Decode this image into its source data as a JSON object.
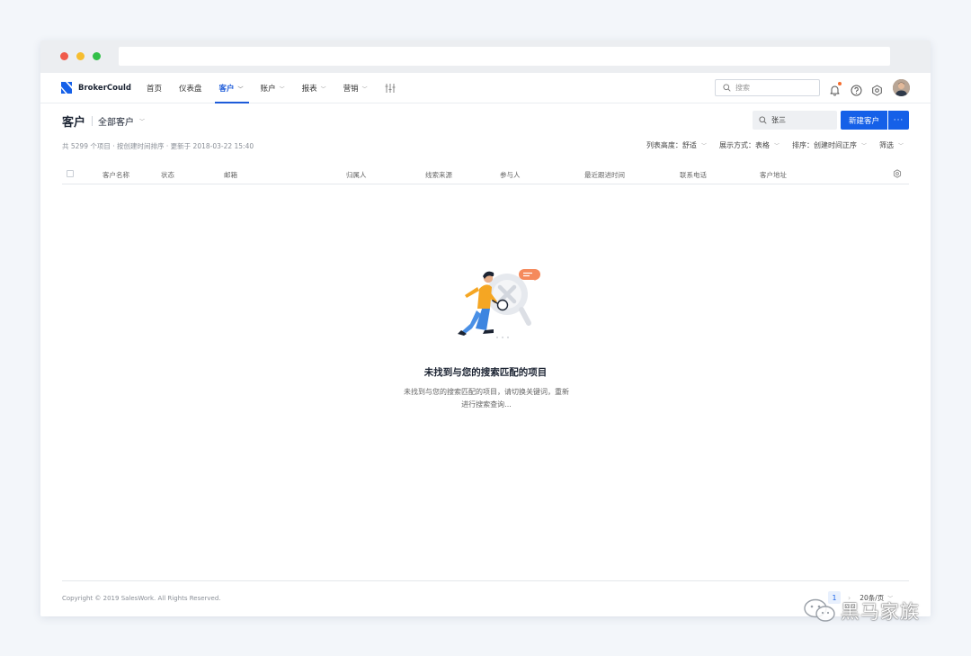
{
  "brand": {
    "name": "BrokerCould"
  },
  "nav": {
    "items": [
      {
        "label": "首页",
        "has_dropdown": false,
        "active": false
      },
      {
        "label": "仪表盘",
        "has_dropdown": false,
        "active": false
      },
      {
        "label": "客户",
        "has_dropdown": true,
        "active": true
      },
      {
        "label": "账户",
        "has_dropdown": true,
        "active": false
      },
      {
        "label": "报表",
        "has_dropdown": true,
        "active": false
      },
      {
        "label": "营销",
        "has_dropdown": true,
        "active": false
      }
    ],
    "search_placeholder": "搜索",
    "notification_dot": true
  },
  "page": {
    "title": "客户",
    "view": "全部客户",
    "search_value": "张三",
    "new_button": "新建客户",
    "more_button": "···",
    "meta": "共 5299 个项目 · 按创建时间排序 · 更新于 2018-03-22 15:40",
    "toolbar": [
      {
        "label": "列表高度：舒适"
      },
      {
        "label": "展示方式：表格"
      },
      {
        "label": "排序：创建时间正序"
      },
      {
        "label": "筛选"
      }
    ]
  },
  "table": {
    "columns": [
      "客户名称",
      "状态",
      "邮箱",
      "归属人",
      "线索来源",
      "参与人",
      "最近跟进时间",
      "联系电话",
      "客户地址"
    ]
  },
  "empty_state": {
    "title": "未找到与您的搜索匹配的项目",
    "desc_line1": "未找到与您的搜索匹配的项目，请切换关键词，重新",
    "desc_line2": "进行搜索查询..."
  },
  "footer": {
    "copyright": "Copyright © 2019 SalesWork. All Rights Reserved.",
    "current_page": "1",
    "next": "›",
    "page_size": "20条/页"
  },
  "watermark": {
    "text": "黑马家族"
  },
  "colors": {
    "primary": "#1560e8",
    "accent_orange": "#f56c2c",
    "text_dark": "#1c2433"
  }
}
